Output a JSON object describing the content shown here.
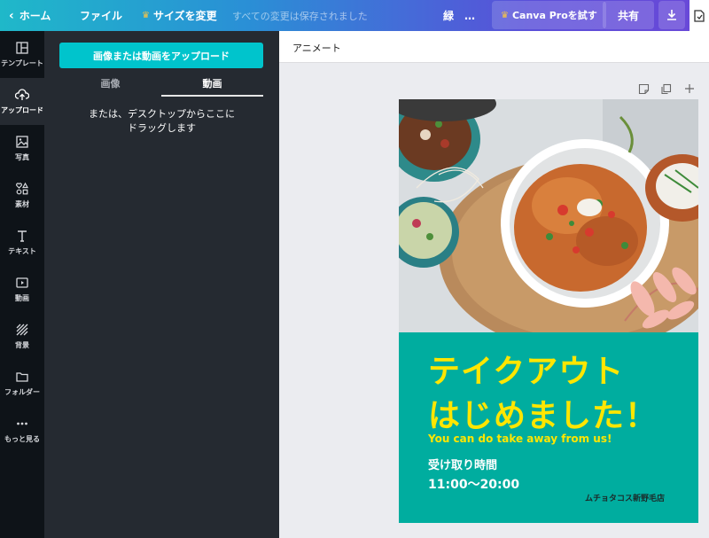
{
  "topbar": {
    "home": "ホーム",
    "file": "ファイル",
    "resize": "サイズを変更",
    "saved": "すべての変更は保存されました",
    "title": "緑　…",
    "pro": "Canva Proを試す",
    "share": "共有"
  },
  "leftnav": {
    "items": [
      {
        "label": "テンプレート",
        "icon": "template-icon"
      },
      {
        "label": "アップロード",
        "icon": "upload-icon"
      },
      {
        "label": "写真",
        "icon": "photo-icon"
      },
      {
        "label": "素材",
        "icon": "elements-icon"
      },
      {
        "label": "テキスト",
        "icon": "text-icon"
      },
      {
        "label": "動画",
        "icon": "video-icon"
      },
      {
        "label": "背景",
        "icon": "background-icon"
      },
      {
        "label": "フォルダー",
        "icon": "folder-icon"
      },
      {
        "label": "もっと見る",
        "icon": "more-icon"
      }
    ]
  },
  "panel": {
    "upload_button": "画像または動画をアップロード",
    "tabs": [
      "画像",
      "動画"
    ],
    "drop_line1": "または、デスクトップからここに",
    "drop_line2": "ドラッグします"
  },
  "editor": {
    "animate": "アニメート"
  },
  "design": {
    "headline1": "テイクアウト",
    "headline2": "はじめました！",
    "subtitle": "You can do take away from us!",
    "pickup_label": "受け取り時間",
    "pickup_time": "11:00〜20:00",
    "shop_name": "ムチョタコス新野毛店"
  },
  "colors": {
    "accent": "#00c4cc",
    "design_bg": "#00ad9f",
    "headline": "#ffe600",
    "panel_bg": "#252a31",
    "nav_bg": "#0e1318"
  }
}
